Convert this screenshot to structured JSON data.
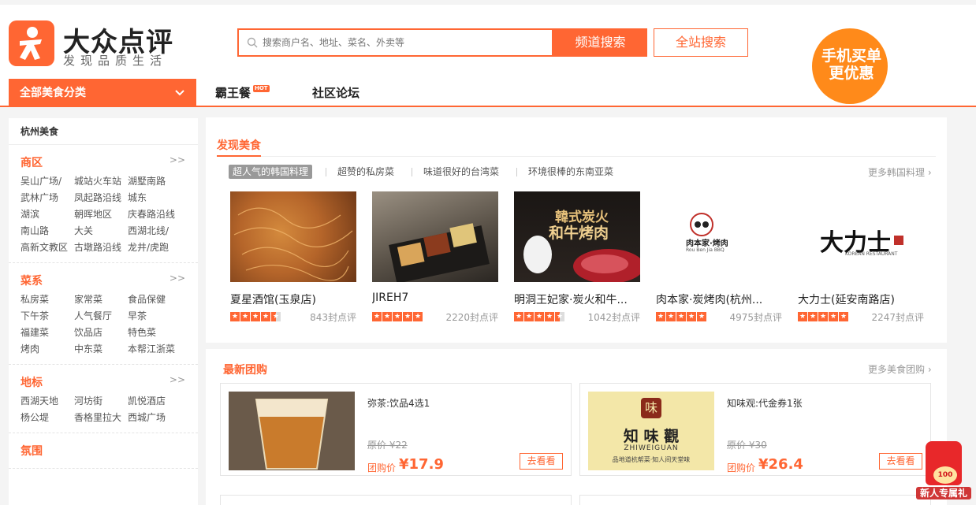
{
  "header": {
    "logo_title": "大众点评",
    "logo_sub": "发现品质生活",
    "search_placeholder": "搜索商户名、地址、菜名、外卖等",
    "btn_channel": "频道搜索",
    "btn_all": "全站搜索",
    "promo_line1": "手机买单",
    "promo_line2": "更优惠"
  },
  "nav": {
    "category": "全部美食分类",
    "items": [
      {
        "label": "霸王餐",
        "badge": "HOT"
      },
      {
        "label": "社区论坛",
        "badge": ""
      }
    ]
  },
  "sidebar": {
    "title": "杭州美食",
    "more": ">>",
    "sections": [
      {
        "title": "商区",
        "items": [
          "吴山广场/",
          "城站火车站",
          "湖墅南路",
          "武林广场",
          "凤起路沿线",
          "城东",
          "湖滨",
          "朝晖地区",
          "庆春路沿线",
          "南山路",
          "大关",
          "西湖北线/",
          "高新文教区",
          "古墩路沿线",
          "龙井/虎跑"
        ]
      },
      {
        "title": "菜系",
        "items": [
          "私房菜",
          "家常菜",
          "食品保健",
          "下午茶",
          "人气餐厅",
          "早茶",
          "福建菜",
          "饮品店",
          "特色菜",
          "烤肉",
          "中东菜",
          "本帮江浙菜"
        ]
      },
      {
        "title": "地标",
        "items": [
          "西湖天地",
          "河坊街",
          "凯悦酒店",
          "杨公堤",
          "香格里拉大",
          "西城广场"
        ]
      },
      {
        "title": "氛围",
        "items": []
      }
    ]
  },
  "discover": {
    "title": "发现美食",
    "tabs": [
      "超人气的韩国料理",
      "超赞的私房菜",
      "味道很好的台湾菜",
      "环境很棒的东南亚菜"
    ],
    "more": "更多韩国料理",
    "cards": [
      {
        "name": "夏星酒馆(玉泉店)",
        "stars": 4.5,
        "reviews": "843封点评"
      },
      {
        "name": "JIREH7",
        "stars": 5,
        "reviews": "2220封点评"
      },
      {
        "name": "明洞王妃家·炭火和牛...",
        "stars": 4.5,
        "reviews": "1042封点评"
      },
      {
        "name": "肉本家·炭烤肉(杭州...",
        "stars": 5,
        "reviews": "4975封点评"
      },
      {
        "name": "大力士(延安南路店)",
        "stars": 5,
        "reviews": "2247封点评"
      }
    ],
    "card_texts": {
      "card3_line1": "韓式炭火",
      "card3_line2": "和牛烤肉",
      "card4_brand": "肉本家·烤肉",
      "card4_sub": "Rou Ben Jia BBQ",
      "card5_brand": "大力士",
      "card5_sub": "KOREAN RESTAURANT"
    }
  },
  "deals": {
    "title": "最新团购",
    "more": "更多美食团购",
    "items": [
      {
        "name": "弥茶:饮品4选1",
        "orig": "原价 ¥22",
        "label": "团购价",
        "price": "¥17.9",
        "btn": "去看看"
      },
      {
        "name": "知味观:代金券1张",
        "orig": "原价 ¥30",
        "label": "团购价",
        "price": "¥26.4",
        "btn": "去看看"
      }
    ],
    "zhiwei": {
      "logo": "味",
      "brand": "知 味 觀",
      "pinyin": "ZHIWEIGUAN",
      "slogan": "品地道杭帮菜·知人间天堂味"
    }
  },
  "redpack": {
    "coin": "100",
    "label": "新人专属礼"
  },
  "colors": {
    "accent": "#ff6633",
    "star": "#ff6633"
  }
}
